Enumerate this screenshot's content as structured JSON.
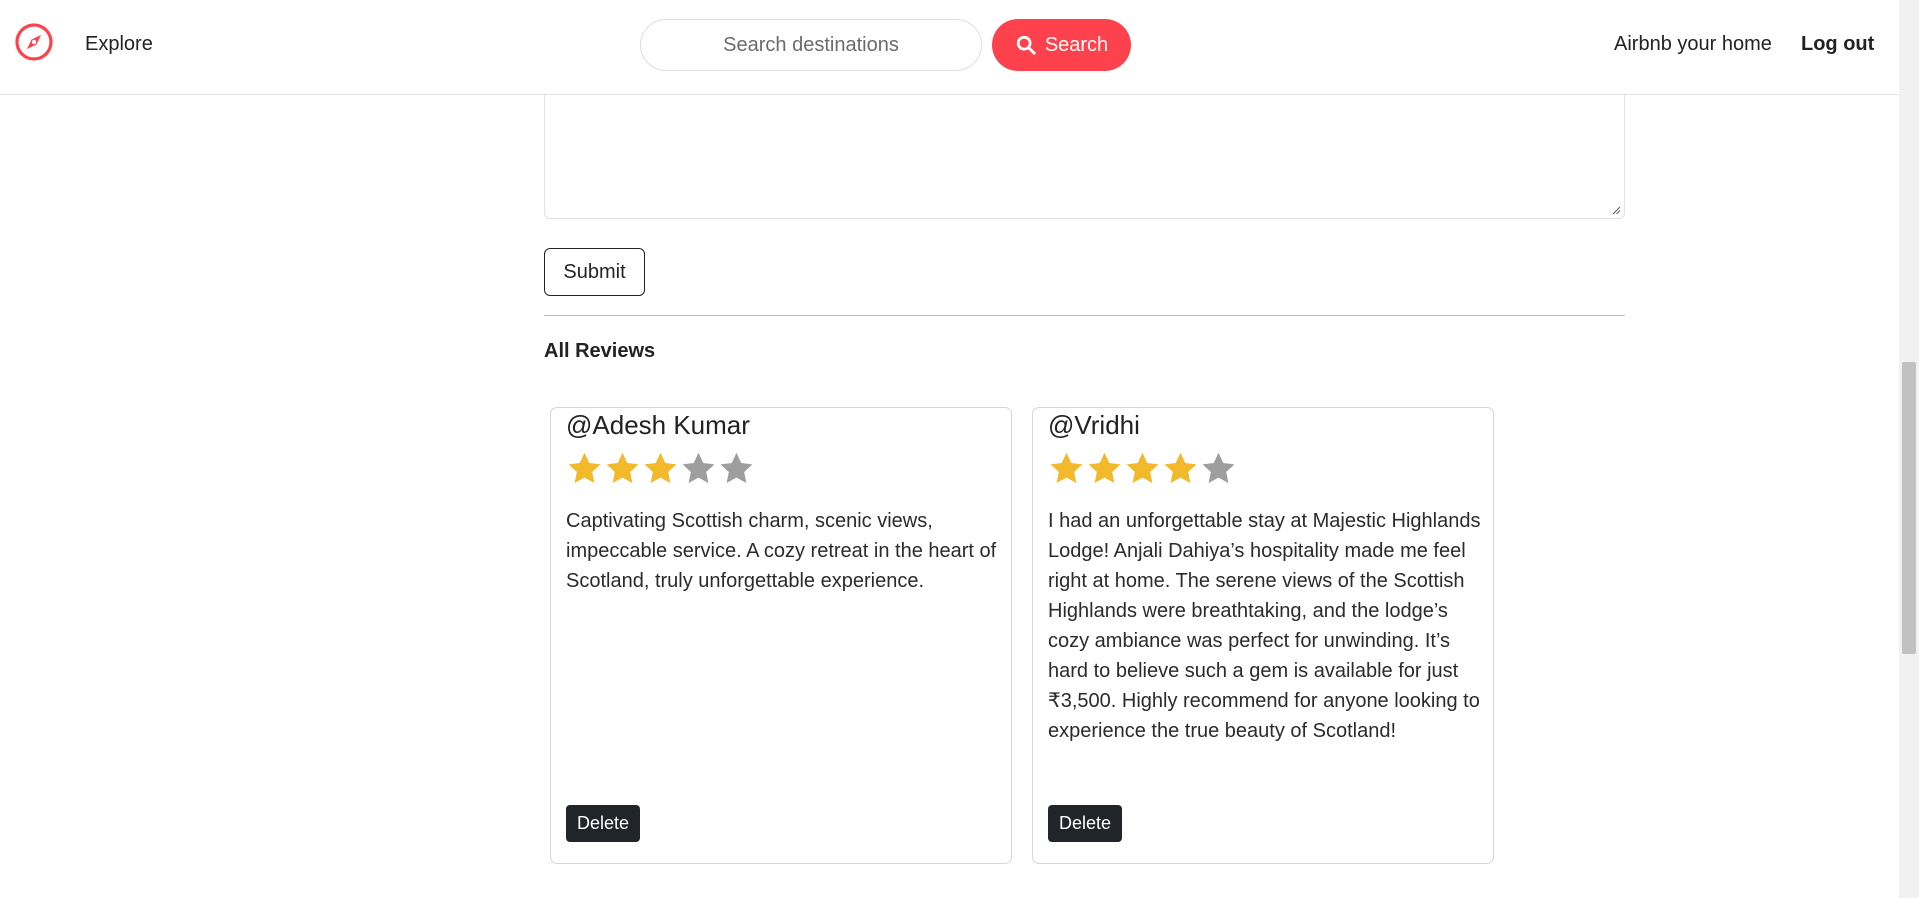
{
  "nav": {
    "brand_icon": "compass-icon",
    "explore_label": "Explore",
    "search_placeholder": "Search destinations",
    "search_button_label": "Search",
    "search_icon": "magnifier-icon",
    "host_label": "Airbnb your home",
    "logout_label": "Log out"
  },
  "form": {
    "submit_label": "Submit"
  },
  "reviews": {
    "heading": "All Reviews",
    "items": [
      {
        "author": "@Adesh Kumar",
        "rating": 3,
        "max_rating": 5,
        "comment": "Captivating Scottish charm, scenic views, impeccable service. A cozy retreat in the heart of Scotland, truly unforgettable experience.",
        "delete_label": "Delete"
      },
      {
        "author": "@Vridhi",
        "rating": 4,
        "max_rating": 5,
        "comment": "I had an unforgettable stay at Majestic Highlands Lodge! Anjali Dahiya’s hospitality made me feel right at home. The serene views of the Scottish Highlands were breathtaking, and the lodge’s cozy ambiance was perfect for unwinding. It’s hard to believe such a gem is available for just ₹3,500. Highly recommend for anyone looking to experience the true beauty of Scotland!",
        "delete_label": "Delete"
      }
    ]
  },
  "colors": {
    "brand": "#fe424d",
    "star_filled": "#f2b92b",
    "star_empty": "#9e9e9e",
    "dark_button": "#212529"
  }
}
